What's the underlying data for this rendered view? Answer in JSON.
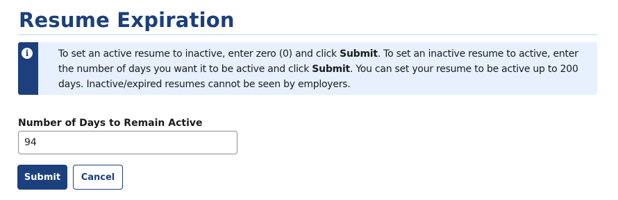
{
  "page": {
    "title": "Resume Expiration"
  },
  "alert": {
    "icon": "info-icon",
    "text_1": "To set an active resume to inactive, enter zero (0) and click ",
    "bold_1": "Submit",
    "text_2": ". To set an inactive resume to active, enter the number of days you want it to be active and click ",
    "bold_2": "Submit",
    "text_3": ". You can set your resume to be active up to 200 days. Inactive/expired resumes cannot be seen by employers."
  },
  "form": {
    "days_label": "Number of Days to Remain Active",
    "days_value": "94"
  },
  "buttons": {
    "submit_label": "Submit",
    "cancel_label": "Cancel"
  },
  "colors": {
    "primary": "#1c3f7d",
    "alert_background": "#e6f1fd",
    "title_rule": "#dbe7f5"
  }
}
